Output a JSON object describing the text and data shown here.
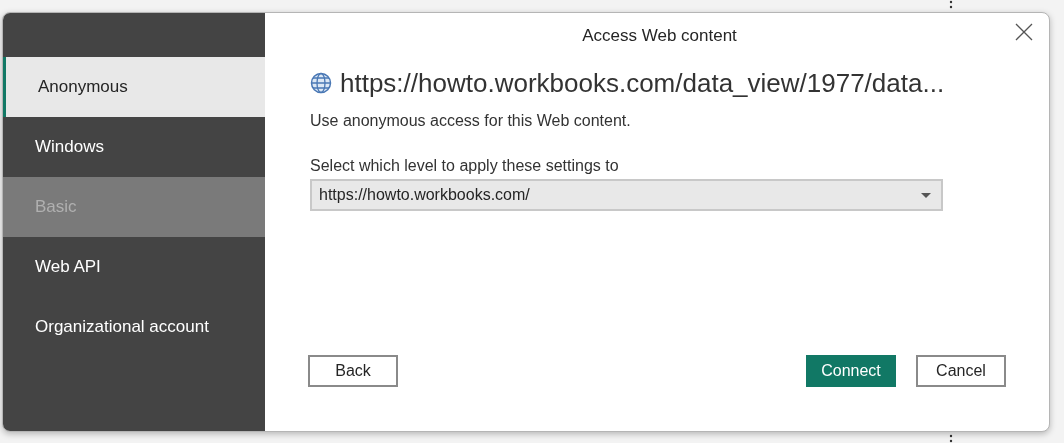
{
  "sidebar": {
    "items": [
      {
        "label": "Anonymous",
        "selected": true,
        "disabled": false
      },
      {
        "label": "Windows",
        "selected": false,
        "disabled": false
      },
      {
        "label": "Basic",
        "selected": false,
        "disabled": true
      },
      {
        "label": "Web API",
        "selected": false,
        "disabled": false
      },
      {
        "label": "Organizational account",
        "selected": false,
        "disabled": false
      }
    ]
  },
  "dialog": {
    "title": "Access Web content",
    "url": "https://howto.workbooks.com/data_view/1977/data...",
    "description": "Use anonymous access for this Web content.",
    "level_label": "Select which level to apply these settings to",
    "level_select": {
      "value": "https://howto.workbooks.com/"
    }
  },
  "buttons": [
    {
      "label": "Back",
      "kind": "secondary"
    },
    {
      "label": "Connect",
      "kind": "primary"
    },
    {
      "label": "Cancel",
      "kind": "secondary"
    }
  ]
}
